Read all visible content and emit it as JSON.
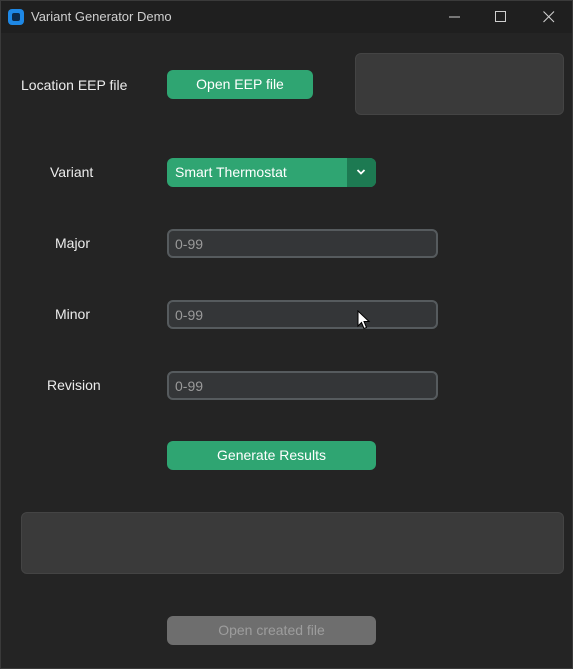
{
  "window": {
    "title": "Variant Generator Demo",
    "controls": [
      "minimize-icon",
      "maximize-icon",
      "close-icon"
    ]
  },
  "eep": {
    "label": "Location EEP file",
    "button": "Open EEP file",
    "path_display": ""
  },
  "variant": {
    "label": "Variant",
    "selected": "Smart Thermostat"
  },
  "major": {
    "label": "Major",
    "value": "",
    "placeholder": "0-99"
  },
  "minor": {
    "label": "Minor",
    "value": "",
    "placeholder": "0-99"
  },
  "revision": {
    "label": "Revision",
    "value": "",
    "placeholder": "0-99"
  },
  "generate_button": "Generate Results",
  "results_text": "",
  "open_created_button": "Open created file",
  "colors": {
    "accent": "#2fa572",
    "accent_dark": "#1d7a52",
    "background": "#242424",
    "panel": "#3a3a3a",
    "entry_bg": "#343638",
    "entry_border": "#565b5e",
    "disabled": "#6e6e6e"
  }
}
